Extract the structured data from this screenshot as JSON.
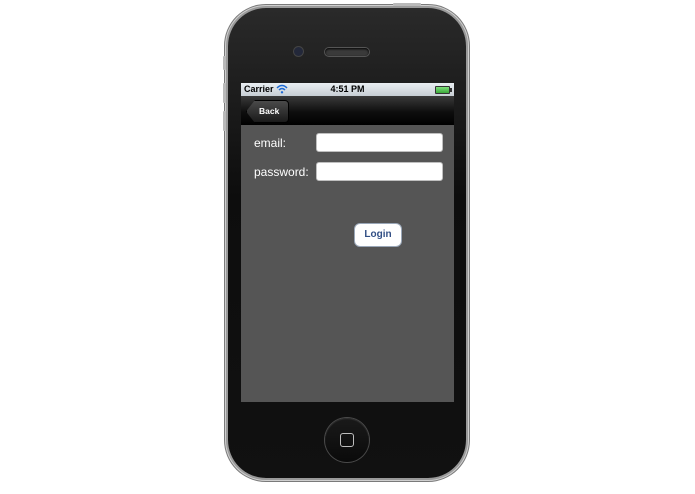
{
  "status_bar": {
    "carrier": "Carrier",
    "time": "4:51 PM",
    "wifi_icon": "wifi-icon",
    "battery_icon": "battery-icon"
  },
  "nav_bar": {
    "back_label": "Back"
  },
  "form": {
    "email_label": "email:",
    "email_value": "",
    "password_label": "password:",
    "password_value": "",
    "login_label": "Login"
  },
  "device": {
    "home_icon": "home-button-icon"
  },
  "colors": {
    "screen_background": "#555555",
    "login_text": "#324f85",
    "battery_fill": "#3aa83a"
  }
}
